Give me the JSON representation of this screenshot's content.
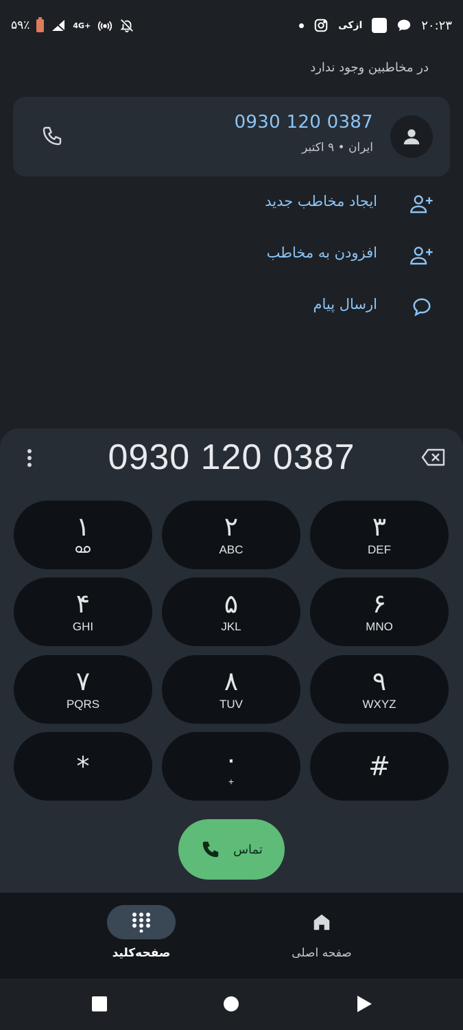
{
  "status_bar": {
    "battery": "۵۹٪",
    "network": "4G+",
    "time": "۲۰:۲۳",
    "app_label": "ازکی"
  },
  "search": {
    "not_in_contacts": "در مخاطبین وجود ندارد"
  },
  "result": {
    "number": "0930 120 0387",
    "subtitle": "ایران • ۹ اکتبر"
  },
  "actions": [
    {
      "label": "ایجاد مخاطب جدید",
      "icon": "person-add-icon"
    },
    {
      "label": "افزودن به مخاطب",
      "icon": "person-add-icon"
    },
    {
      "label": "ارسال پیام",
      "icon": "message-icon"
    }
  ],
  "dialpad": {
    "display_number": "0930 120 0387",
    "keys": [
      {
        "main": "۱",
        "sub": "voicemail"
      },
      {
        "main": "۲",
        "sub": "ABC"
      },
      {
        "main": "۳",
        "sub": "DEF"
      },
      {
        "main": "۴",
        "sub": "GHI"
      },
      {
        "main": "۵",
        "sub": "JKL"
      },
      {
        "main": "۶",
        "sub": "MNO"
      },
      {
        "main": "۷",
        "sub": "PQRS"
      },
      {
        "main": "۸",
        "sub": "TUV"
      },
      {
        "main": "۹",
        "sub": "WXYZ"
      },
      {
        "main": "*",
        "sub": ""
      },
      {
        "main": "۰",
        "sub": "+"
      },
      {
        "main": "#",
        "sub": ""
      }
    ],
    "call_label": "تماس"
  },
  "bottom_nav": {
    "keypad_label": "صفحه‌کلید",
    "home_label": "صفحه اصلی"
  },
  "colors": {
    "accent": "#8cc4f5",
    "call_green": "#5ebc78",
    "background": "#1d2126",
    "card": "#272d35",
    "key": "#0e1216"
  }
}
